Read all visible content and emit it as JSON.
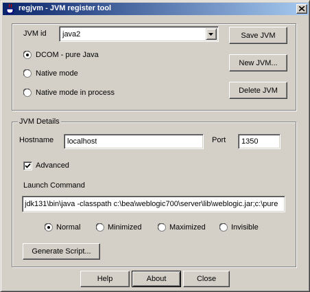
{
  "window": {
    "title": "regjvm - JVM register tool",
    "app_icon": "java-cup-icon",
    "close_icon": "close-icon"
  },
  "jvm_select": {
    "label": "JVM id",
    "value": "java2"
  },
  "buttons": {
    "save": "Save JVM",
    "new": "New JVM...",
    "delete": "Delete JVM",
    "generate": "Generate Script...",
    "help": "Help",
    "about": "About",
    "close": "Close"
  },
  "mode_options": [
    {
      "label": "DCOM - pure Java",
      "selected": true
    },
    {
      "label": "Native mode",
      "selected": false
    },
    {
      "label": "Native mode in process",
      "selected": false
    }
  ],
  "details": {
    "group_title": "JVM Details",
    "hostname_label": "Hostname",
    "hostname_value": "localhost",
    "port_label": "Port",
    "port_value": "1350",
    "advanced_label": "Advanced",
    "advanced_checked": true,
    "launch_label": "Launch Command",
    "launch_value": "jdk131\\bin\\java -classpath c:\\bea\\weblogic700\\server\\lib\\weblogic.jar;c:\\pure"
  },
  "window_options": [
    {
      "label": "Normal",
      "selected": true
    },
    {
      "label": "Minimized",
      "selected": false
    },
    {
      "label": "Maximized",
      "selected": false
    },
    {
      "label": "Invisible",
      "selected": false
    }
  ],
  "colors": {
    "face": "#d4d0c8",
    "title_start": "#0a246a",
    "title_end": "#a6caf0"
  }
}
